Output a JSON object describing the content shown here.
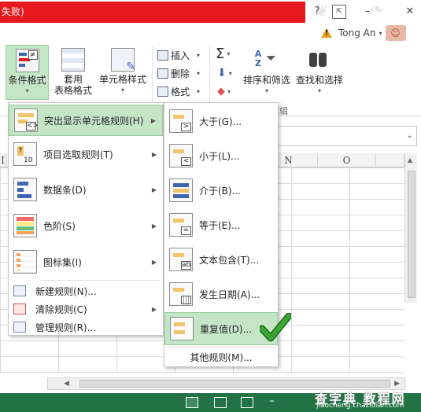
{
  "window": {
    "title_fragment": "失败)",
    "help_button": "?",
    "minimize_button": "–",
    "close_button": "✕",
    "account_name": "Tong An",
    "account_caret": "▾"
  },
  "ribbon": {
    "conditional_format": "条件格式",
    "table_format_line1": "套用",
    "table_format_line2": "表格格式",
    "cell_style": "单元格样式",
    "insert": "插入",
    "delete": "删除",
    "format": "格式",
    "sort_filter": "排序和筛选",
    "find_select": "查找和选择",
    "edit_group_fragment": "辑",
    "sum_symbol": "Σ",
    "sort_letters": "AZ",
    "caret": "▾"
  },
  "columns": [
    "N",
    "O"
  ],
  "column_left_fragment": "I",
  "menu_main": {
    "items": [
      {
        "label": "突出显示单元格规则(H)",
        "icon": "highlight-rules-icon"
      },
      {
        "label": "项目选取规则(T)",
        "icon": "top-bottom-icon"
      },
      {
        "label": "数据条(D)",
        "icon": "data-bars-icon"
      },
      {
        "label": "色阶(S)",
        "icon": "color-scales-icon"
      },
      {
        "label": "图标集(I)",
        "icon": "icon-sets-icon"
      }
    ],
    "small_items": [
      {
        "label": "新建规则(N)...",
        "icon": "new-rule-icon"
      },
      {
        "label": "清除规则(C)",
        "icon": "clear-rules-icon"
      },
      {
        "label": "管理规则(R)...",
        "icon": "manage-rules-icon"
      }
    ],
    "top10_label": "10"
  },
  "menu_sub": {
    "items": [
      {
        "label": "大于(G)...",
        "glyph": ">"
      },
      {
        "label": "小于(L)...",
        "glyph": "<"
      },
      {
        "label": "介于(B)...",
        "glyph": ""
      },
      {
        "label": "等于(E)...",
        "glyph": "="
      },
      {
        "label": "文本包含(T)...",
        "glyph": "ab"
      },
      {
        "label": "发生日期(A)...",
        "glyph": ""
      },
      {
        "label": "重复值(D)...",
        "glyph": ""
      }
    ],
    "other_rules": "其他规则(M)..."
  },
  "watermark": {
    "main": "查字典 教程网",
    "sub": "jiaocheng.chazidian.com"
  },
  "colors": {
    "title_red": "#e8191e",
    "highlight_green": "#c4e5c6",
    "status_green": "#217346",
    "check_green": "#3aa535"
  }
}
